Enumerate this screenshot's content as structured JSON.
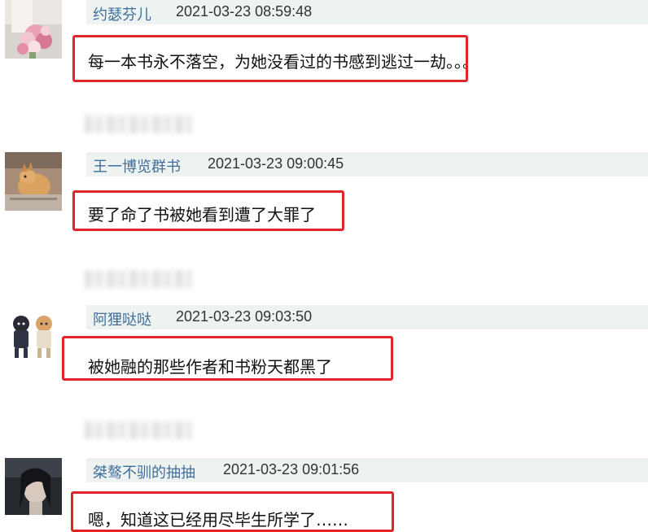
{
  "comments": [
    {
      "username": "约瑟芬儿",
      "timestamp": "2021-03-23 08:59:48",
      "text": "每一本书永不落空，为她没看过的书感到逃过一劫。。。",
      "avatar_icon": "bouquet-avatar"
    },
    {
      "username": "王一博览群书",
      "timestamp": "2021-03-23 09:00:45",
      "text": "要了命了书被她看到遭了大罪了",
      "avatar_icon": "dog-avatar"
    },
    {
      "username": "阿狸哒哒",
      "timestamp": "2021-03-23 09:03:50",
      "text": "被她融的那些作者和书粉天都黑了",
      "avatar_icon": "cartoon-couple-avatar"
    },
    {
      "username": "桀骜不驯的抽抽",
      "timestamp": "2021-03-23 09:01:56",
      "text": "嗯，知道这已经用尽毕生所学了……",
      "avatar_icon": "portrait-avatar"
    }
  ],
  "colors": {
    "highlight": "#e0242a",
    "username": "#3f6f9a",
    "header_bg": "#eef3f2"
  }
}
